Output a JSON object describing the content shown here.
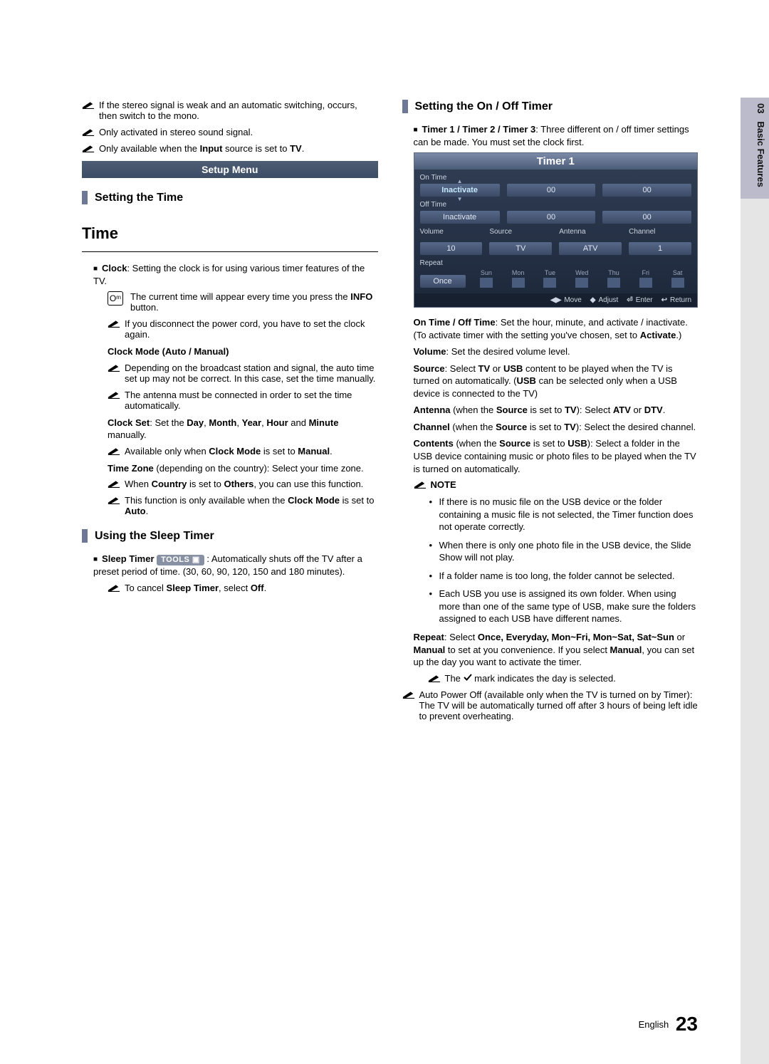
{
  "sidebar": {
    "chapter": "03",
    "section": "Basic Features"
  },
  "left": {
    "notes_top": [
      "If the stereo signal is weak and an automatic switching, occurs, then switch to the mono.",
      "Only activated in stereo sound signal.",
      "Only available when the ",
      " source is set to "
    ],
    "input_word": "Input",
    "tv_word": "TV",
    "setup_menu": "Setup Menu",
    "setting_time": "Setting the Time",
    "time_heading": "Time",
    "clock_label": "Clock",
    "clock_text": ": Setting the clock is for using various timer features of the TV.",
    "info_text_a": "The current time will appear every time you press the ",
    "info_text_b": "INFO",
    "info_text_c": " button.",
    "disconnect_note": "If you disconnect the power cord, you have to set the clock again.",
    "clock_mode_label": "Clock Mode (Auto / Manual)",
    "clock_mode_note1": "Depending on the broadcast station and signal, the auto time set up may not be correct. In this case, set the time manually.",
    "clock_mode_note2": "The antenna must be connected in order to set the time automatically.",
    "clock_set_a": "Clock Set",
    "clock_set_b": ": Set the ",
    "clock_set_c": "Day",
    "clock_set_d": ", ",
    "clock_set_e": "Month",
    "clock_set_f": ", ",
    "clock_set_g": "Year",
    "clock_set_h": ", ",
    "clock_set_i": "Hour",
    "clock_set_j": " and ",
    "clock_set_k": "Minute",
    "clock_set_l": " manually.",
    "avail_note_a": "Available only when ",
    "avail_note_b": "Clock Mode",
    "avail_note_c": " is set to ",
    "avail_note_d": "Manual",
    "time_zone_a": "Time Zone",
    "time_zone_b": " (depending on the country): Select your time zone.",
    "tz_note1_a": "When ",
    "tz_note1_b": "Country",
    "tz_note1_c": " is set to ",
    "tz_note1_d": "Others",
    "tz_note1_e": ", you can use this function.",
    "tz_note2_a": "This function is only available when the ",
    "tz_note2_b": "Clock Mode",
    "tz_note2_c": " is set to ",
    "tz_note2_d": "Auto",
    "sleep_title": "Using the Sleep Timer",
    "sleep_a": "Sleep Timer ",
    "sleep_tools": "TOOLS ▣",
    "sleep_b": " : Automatically shuts off the TV after a preset period of time. (30, 60, 90, 120, 150 and 180 minutes).",
    "cancel_a": "To cancel ",
    "cancel_b": "Sleep Timer",
    "cancel_c": ", select ",
    "cancel_d": "Off",
    "cancel_e": "."
  },
  "right": {
    "onoff_title": "Setting the On / Off Timer",
    "timer_intro_a": "Timer 1 / Timer 2 / Timer 3",
    "timer_intro_b": ": Three different on / off timer settings can be made. You must set the clock first.",
    "fig": {
      "title": "Timer 1",
      "on_time": "On Time",
      "off_time": "Off Time",
      "inactivate": "Inactivate",
      "zero": "00",
      "volume": "Volume",
      "source": "Source",
      "antenna": "Antenna",
      "channel": "Channel",
      "vol_val": "10",
      "src_val": "TV",
      "ant_val": "ATV",
      "ch_val": "1",
      "repeat": "Repeat",
      "once": "Once",
      "days": [
        "Sun",
        "Mon",
        "Tue",
        "Wed",
        "Thu",
        "Fri",
        "Sat"
      ],
      "nav_move": "Move",
      "nav_adjust": "Adjust",
      "nav_enter": "Enter",
      "nav_return": "Return"
    },
    "onoff_a": "On Time / Off Time",
    "onoff_b": ": Set the hour, minute, and activate / inactivate. (To activate timer with the setting you've chosen, set to ",
    "onoff_c": "Activate",
    "onoff_d": ".)",
    "vol_a": "Volume",
    "vol_b": ": Set the desired volume level.",
    "src_a": "Source",
    "src_b": ": Select ",
    "src_c": "TV",
    "src_d": " or ",
    "src_e": "USB",
    "src_f": " content to be played when the TV is turned on automatically. (",
    "src_g": "USB",
    "src_h": " can be selected only when a USB device is connected to the TV)",
    "ant_a": "Antenna",
    "ant_b": " (when the ",
    "ant_c": "Source",
    "ant_d": " is set to ",
    "ant_e": "TV",
    "ant_f": "): Select ",
    "ant_g": "ATV",
    "ant_h": " or ",
    "ant_i": "DTV",
    "ant_j": ".",
    "ch_a": "Channel",
    "ch_b": " (when the ",
    "ch_c": "Source",
    "ch_d": " is set to ",
    "ch_e": "TV",
    "ch_f": "): Select the desired channel.",
    "con_a": "Contents",
    "con_b": " (when the ",
    "con_c": "Source",
    "con_d": " is set to ",
    "con_e": "USB",
    "con_f": "): Select a folder in the USB device containing music or photo files to be played when the TV is turned on automatically.",
    "note_label": "NOTE",
    "note1": "If there is no music file on the USB device or the folder containing a music file is not selected, the Timer function does not operate correctly.",
    "note2": "When there is only one photo file in the USB device, the Slide Show will not play.",
    "note3": "If a folder name is too long, the folder cannot be selected.",
    "note4": "Each USB you use is assigned its own folder. When using more than one of the same type of USB, make sure the folders assigned to each USB have different names.",
    "rep_a": "Repeat",
    "rep_b": ": Select ",
    "rep_c": "Once, Everyday, Mon~Fri, Mon~Sat, Sat~Sun",
    "rep_d": " or ",
    "rep_e": "Manual",
    "rep_f": " to set at you convenience. If you select ",
    "rep_g": "Manual",
    "rep_h": ", you can set up the day you want to activate the timer.",
    "check_note_a": "The ",
    "check_note_b": " mark indicates the day is selected.",
    "auto_off": "Auto Power Off (available only when the TV is turned on by Timer): The TV will be automatically turned off after 3 hours of being left idle to prevent overheating."
  },
  "footer": {
    "lang": "English",
    "page": "23"
  }
}
